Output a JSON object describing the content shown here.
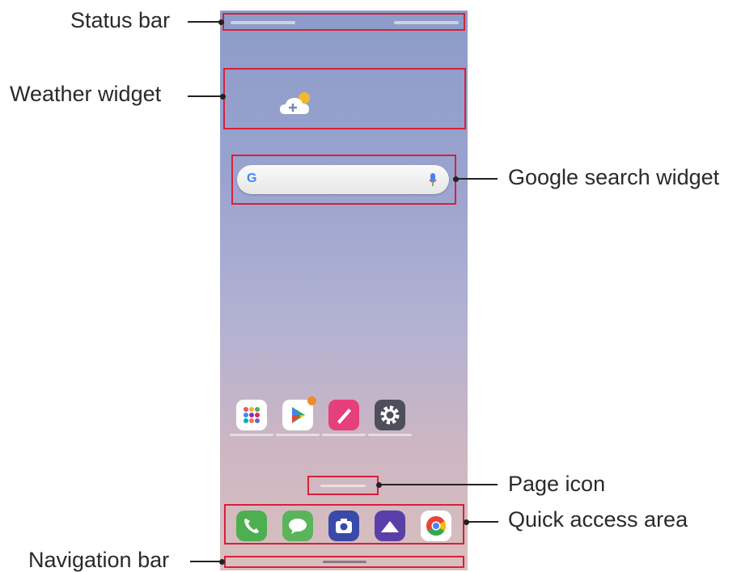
{
  "callouts": {
    "status_bar": "Status bar",
    "weather_widget": "Weather widget",
    "google_search_widget": "Google search widget",
    "page_icon": "Page icon",
    "quick_access_area": "Quick access area",
    "navigation_bar": "Navigation bar"
  },
  "colors": {
    "highlight": "#d6213a",
    "phone_top": "#8c9cc7",
    "phone_bottom": "#d9bfbe"
  },
  "icons": {
    "home_apps": [
      "app-folder-icon",
      "play-store-icon",
      "edit-app-icon",
      "settings-icon"
    ],
    "dock": [
      "phone-icon",
      "messages-icon",
      "camera-icon",
      "gallery-icon",
      "chrome-icon"
    ]
  }
}
